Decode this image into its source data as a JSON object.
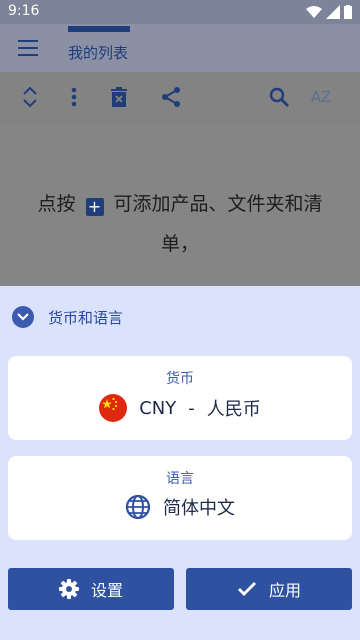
{
  "status": {
    "time": "9:16"
  },
  "header": {
    "tab_label": "我的列表"
  },
  "toolbar": {
    "icons": [
      "expand-collapse-icon",
      "more-vert-icon",
      "delete-list-icon",
      "share-icon",
      "search-icon",
      "sort-az-icon"
    ],
    "sort_label": "AZ"
  },
  "empty_state": {
    "prefix": "点按",
    "plus": "+",
    "suffix": "可添加产品、文件夹和清单，"
  },
  "sheet": {
    "title": "货币和语言",
    "currency": {
      "label": "货币",
      "code": "CNY",
      "separator": "-",
      "name": "人民币"
    },
    "language": {
      "label": "语言",
      "value": "简体中文"
    },
    "settings_button": "设置",
    "apply_button": "应用"
  },
  "colors": {
    "accent": "#2f52a0",
    "sheet_bg": "#dbe2fb",
    "dim_overlay": "#808080"
  }
}
